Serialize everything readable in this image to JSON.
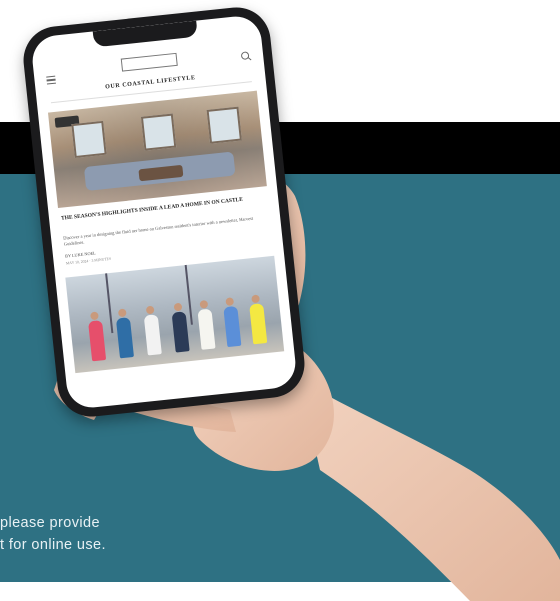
{
  "phone_screen": {
    "logo_text": "",
    "section_title": "OUR COASTAL LIFESTYLE",
    "article_headline": "THE SEASON'S HIGHLIGHTS INSIDE A LEAD A HOME IN ON CASTLE",
    "article_excerpt": "Discover a year in designing the fluid ner home on Galveston resident's interior with a newsletter, Harvest Guidelines.",
    "byline": "BY LUKE NOEL",
    "date": "MAY 10, 2024 · 3 MINUTES"
  },
  "caption": {
    "line1": "please provide",
    "line2": "t for online use."
  },
  "colors": {
    "teal": "#2e7183",
    "band": "#000000",
    "background": "#ffffff"
  }
}
